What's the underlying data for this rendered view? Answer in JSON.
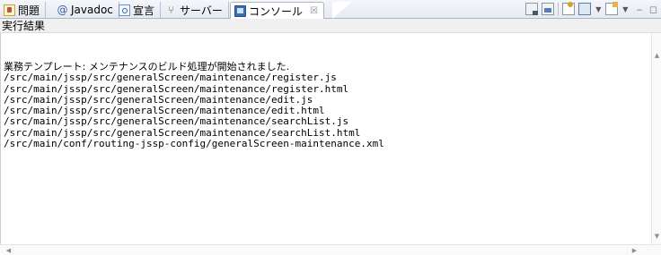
{
  "tabs": [
    {
      "label": "問題",
      "icon": "problems-icon",
      "active": false
    },
    {
      "label": "Javadoc",
      "icon": "javadoc-at-icon",
      "active": false
    },
    {
      "label": "宣言",
      "icon": "declaration-icon",
      "active": false
    },
    {
      "label": "サーバー",
      "icon": "servers-icon",
      "active": false
    },
    {
      "label": "コンソール",
      "icon": "console-icon",
      "active": true,
      "close_glyph": "☒"
    }
  ],
  "toolbar": {
    "buttons": [
      "clear-console-icon",
      "scroll-lock-icon",
      "pin-console-icon",
      "display-selected-console-icon",
      "open-console-icon"
    ]
  },
  "console": {
    "title": "実行結果",
    "lines": [
      "業務テンプレート: メンテナンスのビルド処理が開始されました.",
      "/src/main/jssp/src/generalScreen/maintenance/register.js",
      "/src/main/jssp/src/generalScreen/maintenance/register.html",
      "/src/main/jssp/src/generalScreen/maintenance/edit.js",
      "/src/main/jssp/src/generalScreen/maintenance/edit.html",
      "/src/main/jssp/src/generalScreen/maintenance/searchList.js",
      "/src/main/jssp/src/generalScreen/maintenance/searchList.html",
      "/src/main/conf/routing-jssp-config/generalScreen-maintenance.xml"
    ]
  }
}
